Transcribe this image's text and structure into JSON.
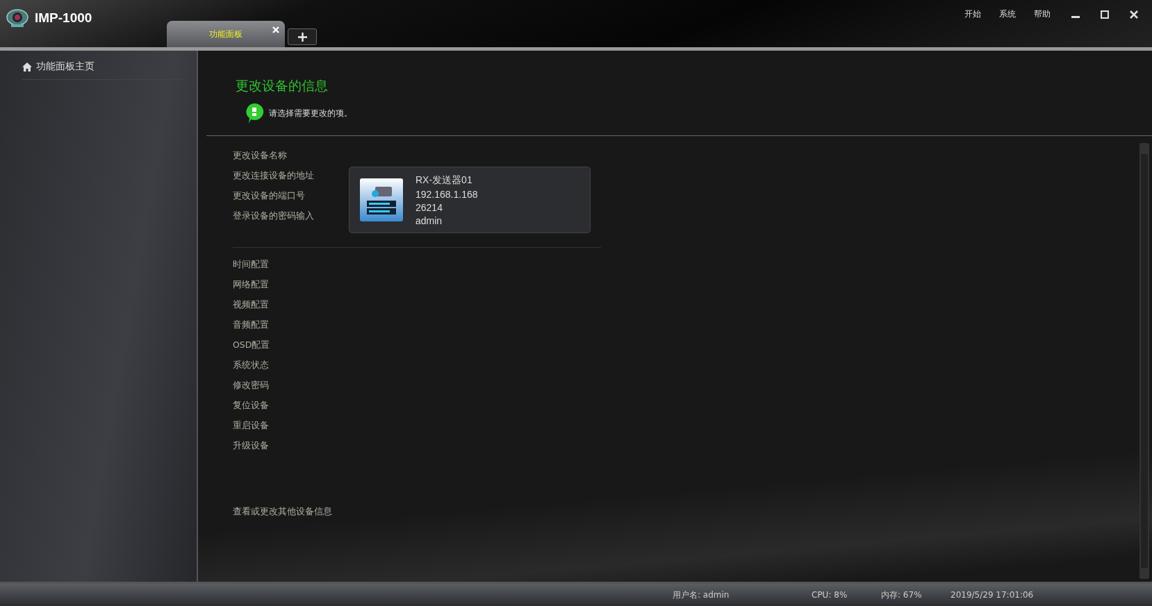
{
  "window": {
    "title": "IMP-1000"
  },
  "menu": [
    "开始",
    "系统",
    "帮助"
  ],
  "tabs": [
    {
      "label": "功能面板",
      "selected": true
    }
  ],
  "sidebar": {
    "items": [
      "功能面板主页"
    ]
  },
  "main": {
    "title": "更改设备的信息",
    "hint": "请选择需要更改的项。",
    "device_options": [
      "更改设备名称",
      "更改连接设备的地址",
      "更改设备的端口号",
      "登录设备的密码输入"
    ],
    "device_card": {
      "name": "RX-发送器01",
      "address": "192.168.1.168",
      "port": "26214",
      "user": "admin"
    },
    "config_items": [
      "时间配置",
      "网络配置",
      "视频配置",
      "音频配置",
      "OSD配置",
      "系统状态",
      "修改密码",
      "复位设备",
      "重启设备",
      "升级设备"
    ],
    "footer_link": "查看或更改其他设备信息"
  },
  "status_bar": {
    "user": "用户名: admin",
    "cpu": "CPU: 8%",
    "memory": "内存: 67%",
    "datetime": "2019/5/29 17:01:06"
  }
}
